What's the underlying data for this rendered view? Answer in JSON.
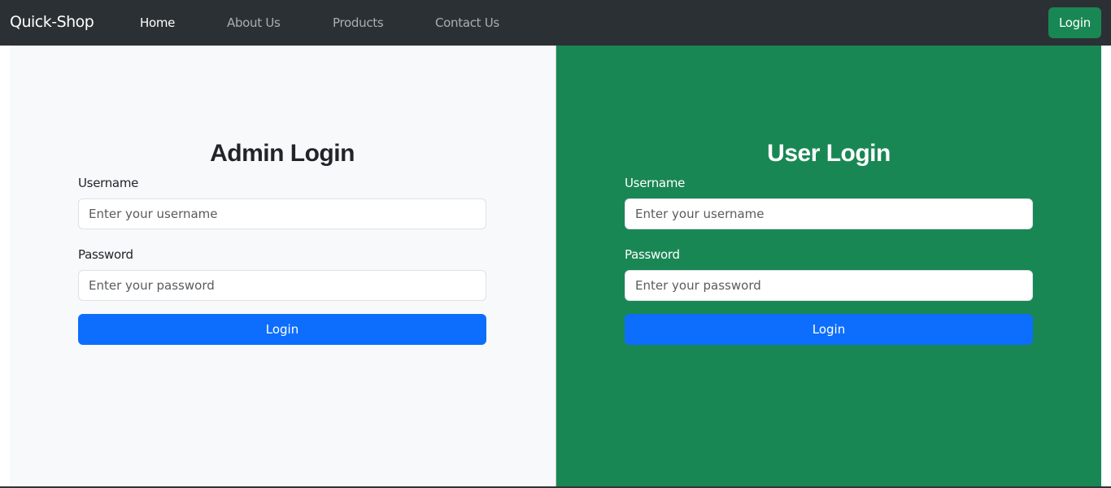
{
  "navbar": {
    "brand": "Quick-Shop",
    "links": [
      "Home",
      "About Us",
      "Products",
      "Contact Us"
    ],
    "login_label": "Login"
  },
  "admin": {
    "title": "Admin Login",
    "username_label": "Username",
    "username_placeholder": "Enter your username",
    "password_label": "Password",
    "password_placeholder": "Enter your password",
    "button": "Login"
  },
  "user": {
    "title": "User Login",
    "username_label": "Username",
    "username_placeholder": "Enter your username",
    "password_label": "Password",
    "password_placeholder": "Enter your password",
    "button": "Login"
  }
}
